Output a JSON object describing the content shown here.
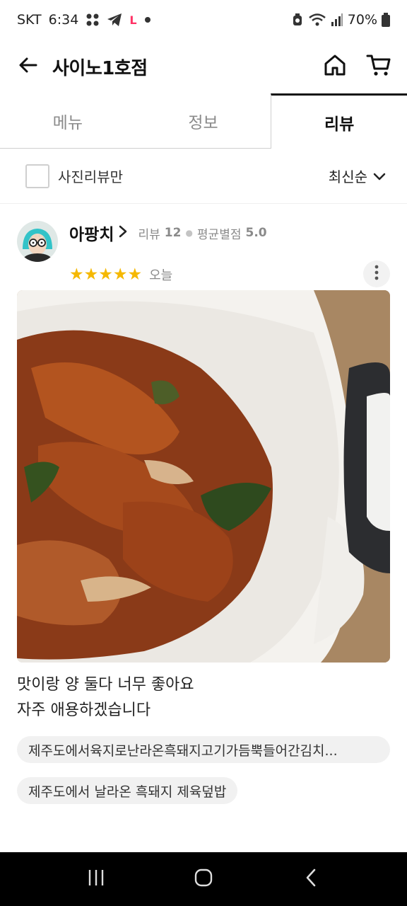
{
  "status_bar": {
    "carrier": "SKT",
    "time": "6:34",
    "notification_letter": "L",
    "battery": "70%",
    "icons": [
      "grid-icon",
      "telegram-icon",
      "l-app-icon",
      "dot-icon",
      "alarm-icon",
      "wifi-icon",
      "signal-icon",
      "battery-icon"
    ]
  },
  "header": {
    "title": "사이노1호점",
    "icons": [
      "back-arrow-icon",
      "home-icon",
      "cart-icon"
    ]
  },
  "tabs": [
    {
      "label": "메뉴",
      "active": false
    },
    {
      "label": "정보",
      "active": false
    },
    {
      "label": "리뷰",
      "active": true
    }
  ],
  "filter": {
    "photo_only_label": "사진리뷰만",
    "sort_label": "최신순"
  },
  "review": {
    "reviewer_name": "아팡치",
    "review_count_label": "리뷰",
    "review_count": "12",
    "avg_rating_label": "평균별점",
    "avg_rating": "5.0",
    "stars": 5,
    "stars_text": "★★★★★",
    "date": "오늘",
    "text_line1": "맛이랑 양 둘다 너무 좋아요",
    "text_line2": "자주 애용하겠습니다",
    "menu_chips": [
      "제주도에서육지로난라온흑돼지고기가듬뿍들어간김치...",
      "제주도에서 날라온 흑돼지 제육덮밥"
    ]
  },
  "colors": {
    "star": "#f5b800",
    "tab_active": "#111111",
    "tab_inactive": "#8a8a8a",
    "nav_bar": "#000000"
  }
}
